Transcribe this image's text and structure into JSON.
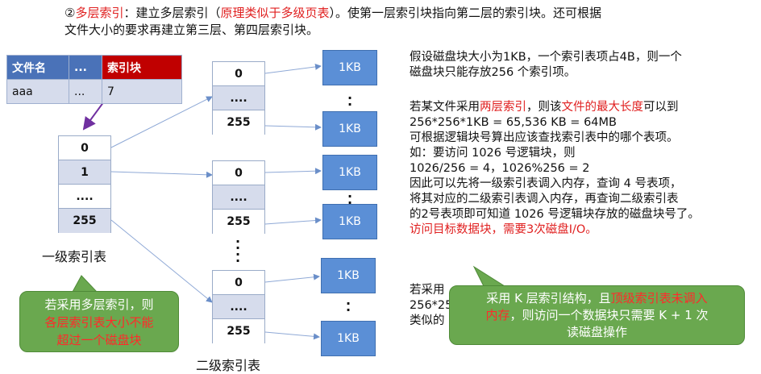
{
  "heading": {
    "p1": "②",
    "p2": "多层索引",
    "p3": "：建立多层索引（",
    "p4": "原理类似于多级页表",
    "p5": "）。使第一层索引块指向第二层的索引块。还可根据",
    "line2": "文件大小的要求再建立第三层、第四层索引块。"
  },
  "dir_table": {
    "headers": [
      "文件名",
      "...",
      "索引块"
    ],
    "row": [
      "aaa",
      "...",
      "7"
    ]
  },
  "first_level": {
    "cells": [
      "0",
      "1",
      "....",
      "255"
    ],
    "caption": "一级索引表"
  },
  "second_level": {
    "blocks": [
      [
        "0",
        "....",
        "255"
      ],
      [
        "0",
        "....",
        "255"
      ],
      [
        "0",
        "....",
        "255"
      ]
    ],
    "caption": "二级索引表"
  },
  "data_block_label": "1KB",
  "right_text": {
    "p1a": "假设磁盘块大小为1KB，一个索引表项占4B，则一个",
    "p1b": "磁盘块只能存放256 个索引项。",
    "p2a": "若某文件采用",
    "p2b": "两层索引",
    "p2c": "，则该",
    "p2d": "文件的最大长度",
    "p2e": "可以到",
    "p3": "256*256*1KB = 65,536 KB = 64MB",
    "p4": "可根据逻辑块号算出应该查找索引表中的哪个表项。",
    "p5": "如：要访问 1026 号逻辑块，则",
    "p6": "1026/256 = 4，1026%256 = 2",
    "p7": "因此可以先将一级索引表调入内存，查询 4 号表项，",
    "p8": "将其对应的二级索引表调入内存，再查询二级索引表",
    "p9": "的2号表项即可知道 1026 号逻辑块存放的磁盘块号了。",
    "p10": "访问目标数据块，需要3次磁盘I/O。",
    "p11": "若采用",
    "p12": "256*25",
    "p13": "类似的"
  },
  "callout_left": {
    "l1": "若采用多层索引，则",
    "l2": "各层索引表大小不能",
    "l3": "超过一个磁盘块"
  },
  "callout_right": {
    "a": "采用 K 层索引结构，且",
    "b": "顶级索引表未调入",
    "c": "内存",
    "d": "，则访问一个数据块只需要 K + 1 次",
    "e": "读磁盘操作"
  },
  "colors": {
    "red": "#e02020",
    "blue": "#5b8fd6",
    "green": "#6aa84f",
    "header_blue": "#4a72b8",
    "header_red": "#c00000"
  }
}
